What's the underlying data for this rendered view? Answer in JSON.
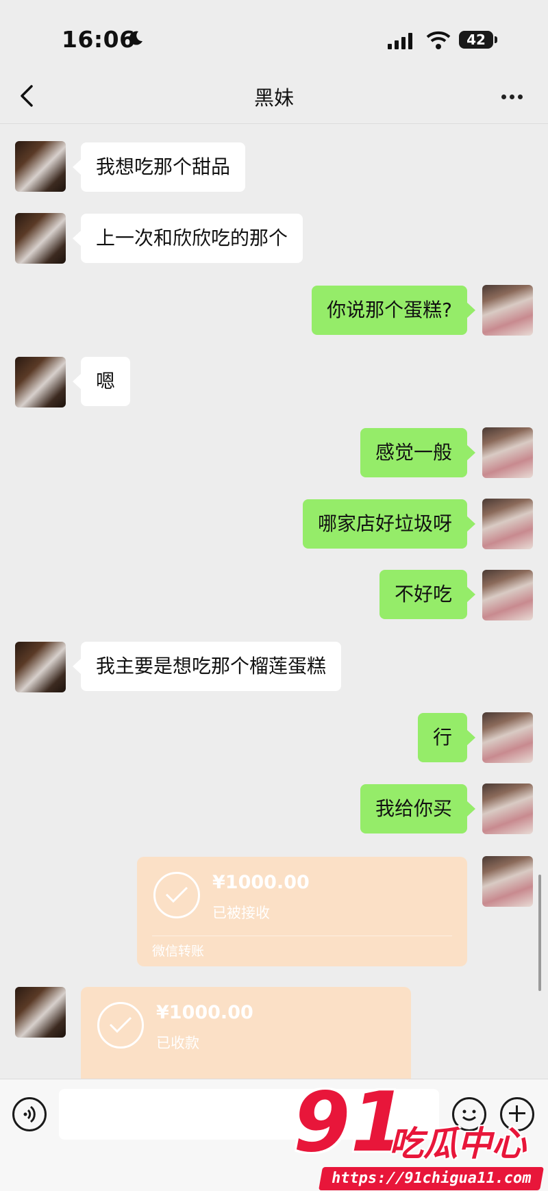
{
  "status_bar": {
    "time": "16:06",
    "battery": "42"
  },
  "header": {
    "contact_name": "黑妹"
  },
  "messages": [
    {
      "text": "我想吃那个甜品"
    },
    {
      "text": "上一次和欣欣吃的那个"
    },
    {
      "text": "你说那个蛋糕?"
    },
    {
      "text": "嗯"
    },
    {
      "text": "感觉一般"
    },
    {
      "text": "哪家店好垃圾呀"
    },
    {
      "text": "不好吃"
    },
    {
      "text": "我主要是想吃那个榴莲蛋糕"
    },
    {
      "text": "行"
    },
    {
      "text": "我给你买"
    }
  ],
  "transfers": [
    {
      "amount": "¥1000.00",
      "status": "已被接收",
      "footer": "微信转账"
    },
    {
      "amount": "¥1000.00",
      "status": "已收款"
    }
  ],
  "watermark": {
    "logo": "91",
    "name": "吃瓜中心",
    "url": "https://91chigua11.com"
  },
  "icons": {
    "back": "chevron-left-icon",
    "more": "more-dots-icon",
    "voice": "voice-icon",
    "emoji": "emoji-icon",
    "plus": "plus-icon"
  }
}
